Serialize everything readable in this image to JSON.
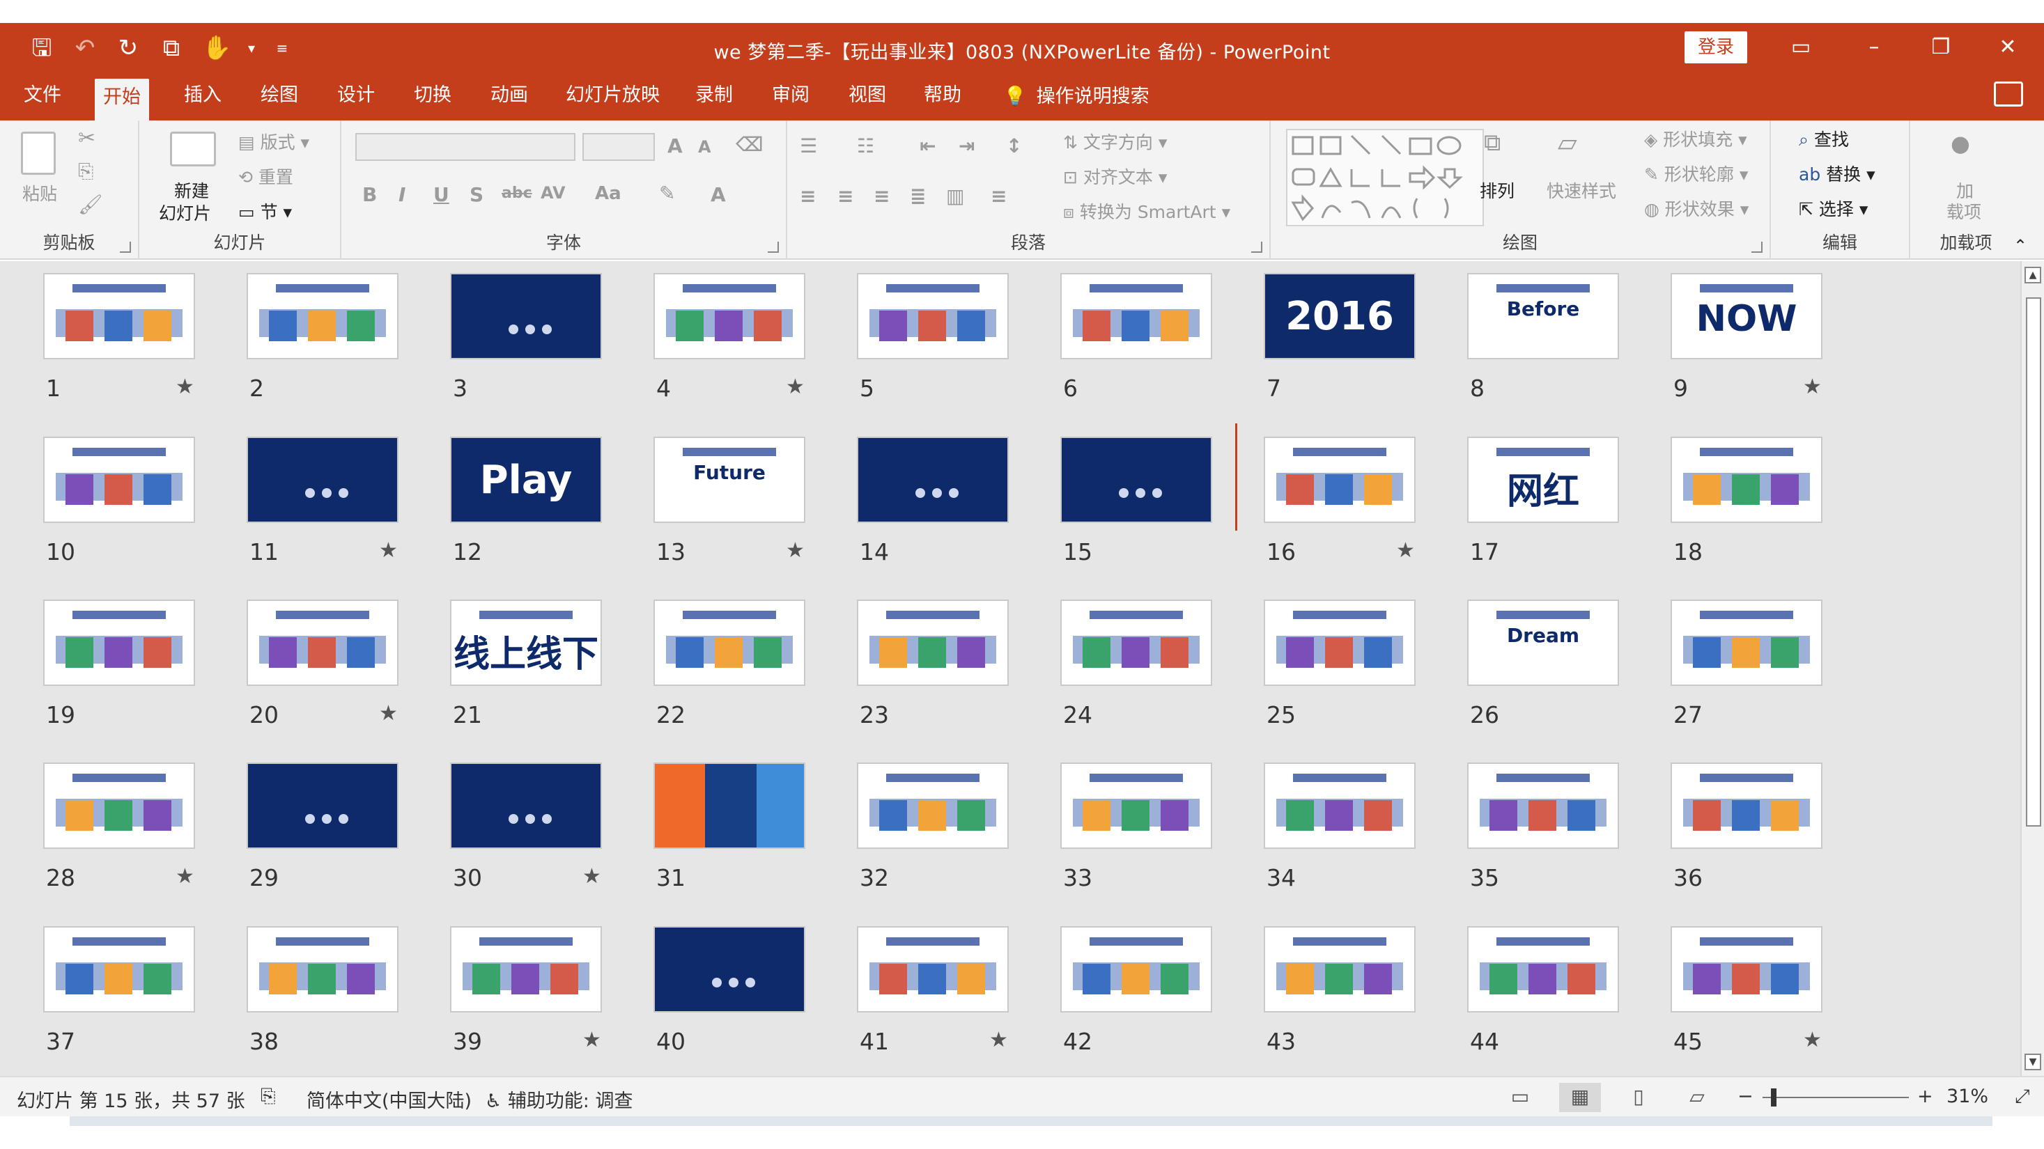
{
  "window": {
    "title": "we 梦第二季-【玩出事业来】0803 (NXPowerLite 备份)  -  PowerPoint",
    "login_label": "登录"
  },
  "tabs": [
    "文件",
    "开始",
    "插入",
    "绘图",
    "设计",
    "切换",
    "动画",
    "幻灯片放映",
    "录制",
    "审阅",
    "视图",
    "帮助"
  ],
  "tell_me": "操作说明搜索",
  "ribbon": {
    "groups": [
      "剪贴板",
      "幻灯片",
      "字体",
      "段落",
      "绘图",
      "编辑",
      "加载项"
    ],
    "clipboard": {
      "paste": "粘贴"
    },
    "slides": {
      "new_slide_line1": "新建",
      "new_slide_line2": "幻灯片",
      "layout": "版式",
      "reset": "重置",
      "section": "节"
    },
    "paragraph": {
      "text_direction": "文字方向",
      "align_text": "对齐文本",
      "smartart": "转换为 SmartArt"
    },
    "drawing": {
      "arrange": "排列",
      "quick_styles": "快速样式",
      "shape_fill": "形状填充",
      "shape_outline": "形状轮廓",
      "shape_effects": "形状效果"
    },
    "editing": {
      "find": "查找",
      "replace": "替换",
      "select": "选择"
    },
    "addins": {
      "label_line1": "加",
      "label_line2": "载项"
    },
    "font_symbols": [
      "B",
      "I",
      "U",
      "S",
      "abc",
      "AV",
      "Aa",
      "A"
    ]
  },
  "slides": [
    {
      "n": "1",
      "star": true,
      "style": "light"
    },
    {
      "n": "2",
      "star": false,
      "style": "light"
    },
    {
      "n": "3",
      "star": false,
      "style": "dark"
    },
    {
      "n": "4",
      "star": true,
      "style": "light"
    },
    {
      "n": "5",
      "star": false,
      "style": "light"
    },
    {
      "n": "6",
      "star": false,
      "style": "light"
    },
    {
      "n": "7",
      "star": false,
      "style": "dark",
      "text": "2016"
    },
    {
      "n": "8",
      "star": false,
      "style": "light",
      "text": "Before"
    },
    {
      "n": "9",
      "star": true,
      "style": "light",
      "text": "NOW"
    },
    {
      "n": "10",
      "star": false,
      "style": "light"
    },
    {
      "n": "11",
      "star": true,
      "style": "dark"
    },
    {
      "n": "12",
      "star": false,
      "style": "dark",
      "text": "Play"
    },
    {
      "n": "13",
      "star": true,
      "style": "light",
      "text": "Future"
    },
    {
      "n": "14",
      "star": false,
      "style": "dark"
    },
    {
      "n": "15",
      "star": false,
      "style": "dark"
    },
    {
      "n": "16",
      "star": true,
      "style": "light"
    },
    {
      "n": "17",
      "star": false,
      "style": "light",
      "text": "网红"
    },
    {
      "n": "18",
      "star": false,
      "style": "light"
    },
    {
      "n": "19",
      "star": false,
      "style": "light"
    },
    {
      "n": "20",
      "star": true,
      "style": "light"
    },
    {
      "n": "21",
      "star": false,
      "style": "light",
      "text": "线上线下"
    },
    {
      "n": "22",
      "star": false,
      "style": "light"
    },
    {
      "n": "23",
      "star": false,
      "style": "light"
    },
    {
      "n": "24",
      "star": false,
      "style": "light"
    },
    {
      "n": "25",
      "star": false,
      "style": "light"
    },
    {
      "n": "26",
      "star": false,
      "style": "light",
      "text": "Dream"
    },
    {
      "n": "27",
      "star": false,
      "style": "light"
    },
    {
      "n": "28",
      "star": true,
      "style": "light"
    },
    {
      "n": "29",
      "star": false,
      "style": "dark"
    },
    {
      "n": "30",
      "star": true,
      "style": "dark"
    },
    {
      "n": "31",
      "star": false,
      "style": "split"
    },
    {
      "n": "32",
      "star": false,
      "style": "light"
    },
    {
      "n": "33",
      "star": false,
      "style": "light"
    },
    {
      "n": "34",
      "star": false,
      "style": "light"
    },
    {
      "n": "35",
      "star": false,
      "style": "light"
    },
    {
      "n": "36",
      "star": false,
      "style": "light"
    },
    {
      "n": "37",
      "star": false,
      "style": "light"
    },
    {
      "n": "38",
      "star": false,
      "style": "light"
    },
    {
      "n": "39",
      "star": true,
      "style": "light"
    },
    {
      "n": "40",
      "star": false,
      "style": "dark"
    },
    {
      "n": "41",
      "star": true,
      "style": "light"
    },
    {
      "n": "42",
      "star": false,
      "style": "light"
    },
    {
      "n": "43",
      "star": false,
      "style": "light"
    },
    {
      "n": "44",
      "star": false,
      "style": "light"
    },
    {
      "n": "45",
      "star": true,
      "style": "light"
    }
  ],
  "status": {
    "slide_info": "幻灯片 第 15 张，共 57 张",
    "language": "简体中文(中国大陆)",
    "accessibility": "辅助功能: 调查",
    "zoom": "31%",
    "zoom_minus": "−",
    "zoom_plus": "+"
  },
  "colors": {
    "accent": "#c43e1c",
    "slide_dark": "#0e2a6a",
    "sorter_bg": "#e6e6e6"
  }
}
